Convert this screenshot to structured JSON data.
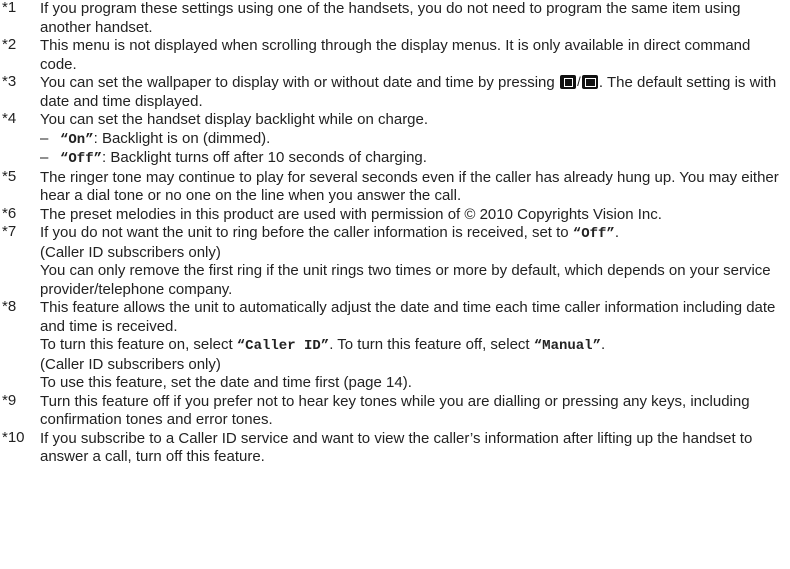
{
  "notes": [
    {
      "num": "*1",
      "text": "If you program these settings using one of the handsets, you do not need to program the same item using another handset."
    },
    {
      "num": "*2",
      "text": "This menu is not displayed when scrolling through the display menus. It is only available in direct command code."
    },
    {
      "num": "*3",
      "text_a": "You can set the wallpaper to display with or without date and time by pressing ",
      "icon": "phone-display-key-icon",
      "text_b": ". The default setting is with date and time displayed."
    },
    {
      "num": "*4",
      "text": "You can set the handset display backlight while on charge.",
      "items": [
        {
          "dash": "–",
          "code": "“On”",
          "text": ": Backlight is on (dimmed)."
        },
        {
          "dash": "–",
          "code": "“Off”",
          "text": ": Backlight turns off after 10 seconds of charging."
        }
      ]
    },
    {
      "num": "*5",
      "text": "The ringer tone may continue to play for several seconds even if the caller has already hung up. You may either hear a dial tone or no one on the line when you answer the call."
    },
    {
      "num": "*6",
      "text": "The preset melodies in this product are used with permission of © 2010 Copyrights Vision Inc."
    },
    {
      "num": "*7",
      "text_a": "If you do not want the unit to ring before the caller information is received, set to ",
      "code": "“Off”",
      "text_b": ".",
      "line2": "(Caller ID subscribers only)",
      "line3": "You can only remove the first ring if the unit rings two times or more by default, which depends on your service provider/telephone company."
    },
    {
      "num": "*8",
      "text": "This feature allows the unit to automatically adjust the date and time each time caller information including date and time is received.",
      "line2_a": "To turn this feature on, select ",
      "code1": "“Caller ID”",
      "line2_b": ". To turn this feature off, select ",
      "code2": "“Manual”",
      "line2_c": ".",
      "line3": "(Caller ID subscribers only)",
      "line4": "To use this feature, set the date and time first (page 14)."
    },
    {
      "num": "*9",
      "text": "Turn this feature off if you prefer not to hear key tones while you are dialling or pressing any keys, including confirmation tones and error tones."
    },
    {
      "num": "*10",
      "text": "If you subscribe to a Caller ID service and want to view the caller’s information after lifting up the handset to answer a call, turn off this feature."
    }
  ]
}
